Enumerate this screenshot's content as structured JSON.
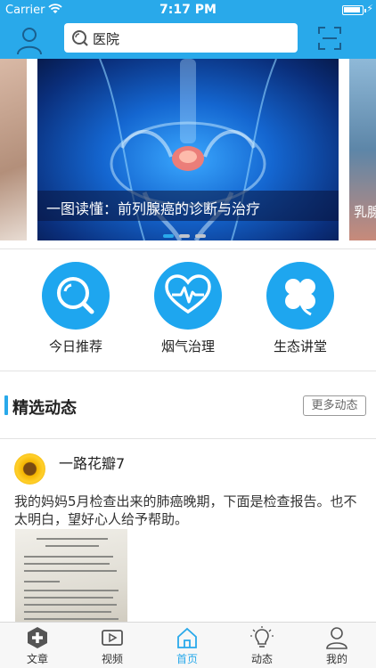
{
  "status": {
    "carrier": "Carrier",
    "time": "7:17 PM"
  },
  "search": {
    "query": "医院"
  },
  "banner": {
    "caption": "一图读懂：前列腺癌的诊断与治疗",
    "next_caption": "乳腺",
    "dots": 3,
    "active_dot": 1
  },
  "quick_menu": [
    {
      "label": "今日推荐",
      "icon": "search-icon"
    },
    {
      "label": "烟气治理",
      "icon": "heartbeat-icon"
    },
    {
      "label": "生态讲堂",
      "icon": "clover-icon"
    }
  ],
  "section": {
    "title": "精选动态",
    "more": "更多动态"
  },
  "post": {
    "user": "一路花瓣7",
    "text": "我的妈妈5月检查出来的肺癌晚期，下面是检查报告。也不太明白，望好心人给予帮助。"
  },
  "tabs": [
    {
      "label": "文章",
      "icon": "plus-cross-icon",
      "active": false
    },
    {
      "label": "视频",
      "icon": "video-icon",
      "active": false
    },
    {
      "label": "首页",
      "icon": "home-icon",
      "active": true
    },
    {
      "label": "动态",
      "icon": "lightbulb-icon",
      "active": false
    },
    {
      "label": "我的",
      "icon": "user-icon",
      "active": false
    }
  ],
  "colors": {
    "primary": "#29a9ea",
    "icon_circle": "#1ea6ef"
  }
}
